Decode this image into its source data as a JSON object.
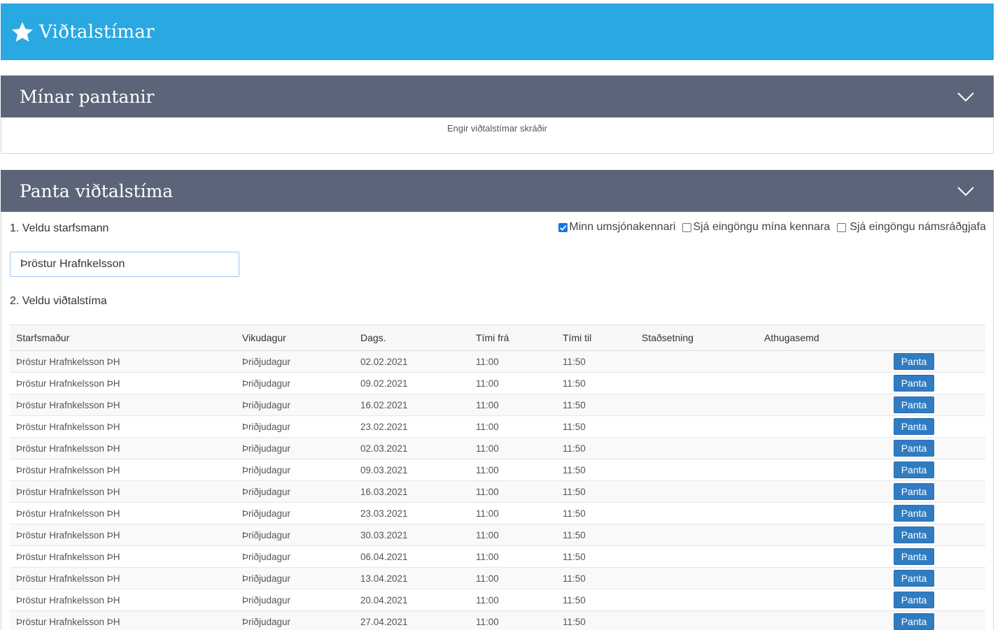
{
  "header": {
    "title": "Viðtalstímar",
    "icon": "star-icon",
    "color": "#29a8e2"
  },
  "my_bookings": {
    "title": "Mínar pantanir",
    "empty_text": "Engir viðtalstímar skráðir"
  },
  "book": {
    "title": "Panta viðtalstíma",
    "step1_label": "1. Veldu starfsmann",
    "step2_label": "2. Veldu viðtalstíma",
    "staff_value": "Þröstur Hrafnkelsson",
    "filters": [
      {
        "label": "Minn umsjónakennari",
        "checked": true
      },
      {
        "label": "Sjá eingöngu mína kennara",
        "checked": false
      },
      {
        "label": "Sjá eingöngu námsráðgjafa",
        "checked": false
      }
    ],
    "columns": [
      "Starfsmaður",
      "Vikudagur",
      "Dags.",
      "Tími frá",
      "Tími til",
      "Staðsetning",
      "Athugasemd",
      ""
    ],
    "book_button_label": "Panta",
    "rows": [
      {
        "staff": "Þröstur Hrafnkelsson ÞH",
        "weekday": "Þriðjudagur",
        "date": "02.02.2021",
        "from": "11:00",
        "to": "11:50",
        "location": "",
        "note": ""
      },
      {
        "staff": "Þröstur Hrafnkelsson ÞH",
        "weekday": "Þriðjudagur",
        "date": "09.02.2021",
        "from": "11:00",
        "to": "11:50",
        "location": "",
        "note": ""
      },
      {
        "staff": "Þröstur Hrafnkelsson ÞH",
        "weekday": "Þriðjudagur",
        "date": "16.02.2021",
        "from": "11:00",
        "to": "11:50",
        "location": "",
        "note": ""
      },
      {
        "staff": "Þröstur Hrafnkelsson ÞH",
        "weekday": "Þriðjudagur",
        "date": "23.02.2021",
        "from": "11:00",
        "to": "11:50",
        "location": "",
        "note": ""
      },
      {
        "staff": "Þröstur Hrafnkelsson ÞH",
        "weekday": "Þriðjudagur",
        "date": "02.03.2021",
        "from": "11:00",
        "to": "11:50",
        "location": "",
        "note": ""
      },
      {
        "staff": "Þröstur Hrafnkelsson ÞH",
        "weekday": "Þriðjudagur",
        "date": "09.03.2021",
        "from": "11:00",
        "to": "11:50",
        "location": "",
        "note": ""
      },
      {
        "staff": "Þröstur Hrafnkelsson ÞH",
        "weekday": "Þriðjudagur",
        "date": "16.03.2021",
        "from": "11:00",
        "to": "11:50",
        "location": "",
        "note": ""
      },
      {
        "staff": "Þröstur Hrafnkelsson ÞH",
        "weekday": "Þriðjudagur",
        "date": "23.03.2021",
        "from": "11:00",
        "to": "11:50",
        "location": "",
        "note": ""
      },
      {
        "staff": "Þröstur Hrafnkelsson ÞH",
        "weekday": "Þriðjudagur",
        "date": "30.03.2021",
        "from": "11:00",
        "to": "11:50",
        "location": "",
        "note": ""
      },
      {
        "staff": "Þröstur Hrafnkelsson ÞH",
        "weekday": "Þriðjudagur",
        "date": "06.04.2021",
        "from": "11:00",
        "to": "11:50",
        "location": "",
        "note": ""
      },
      {
        "staff": "Þröstur Hrafnkelsson ÞH",
        "weekday": "Þriðjudagur",
        "date": "13.04.2021",
        "from": "11:00",
        "to": "11:50",
        "location": "",
        "note": ""
      },
      {
        "staff": "Þröstur Hrafnkelsson ÞH",
        "weekday": "Þriðjudagur",
        "date": "20.04.2021",
        "from": "11:00",
        "to": "11:50",
        "location": "",
        "note": ""
      },
      {
        "staff": "Þröstur Hrafnkelsson ÞH",
        "weekday": "Þriðjudagur",
        "date": "27.04.2021",
        "from": "11:00",
        "to": "11:50",
        "location": "",
        "note": ""
      }
    ]
  },
  "colors": {
    "panel_header": "#5b6478",
    "button": "#2f7cc3"
  }
}
